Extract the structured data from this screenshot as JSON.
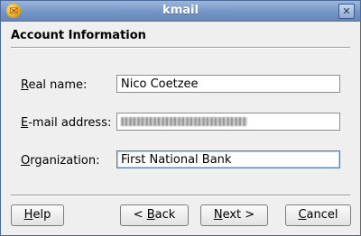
{
  "window": {
    "title": "kmail",
    "close_glyph": "✕",
    "app_icon": "kmail-app-icon"
  },
  "page": {
    "heading": "Account Information"
  },
  "form": {
    "real_name": {
      "label_accel": "R",
      "label_rest": "eal name:",
      "value": "Nico Coetzee"
    },
    "email": {
      "label_accel": "E",
      "label_rest": "-mail address:",
      "value": ""
    },
    "organization": {
      "label_accel": "O",
      "label_rest": "rganization:",
      "value": "First National Bank"
    }
  },
  "buttons": {
    "help": {
      "accel": "H",
      "rest": "elp"
    },
    "back_prefix": "< ",
    "back": {
      "accel": "B",
      "rest": "ack"
    },
    "next": {
      "accel": "N",
      "rest": "ext"
    },
    "next_suffix": " >",
    "cancel": {
      "accel": "C",
      "rest": "ancel"
    }
  }
}
